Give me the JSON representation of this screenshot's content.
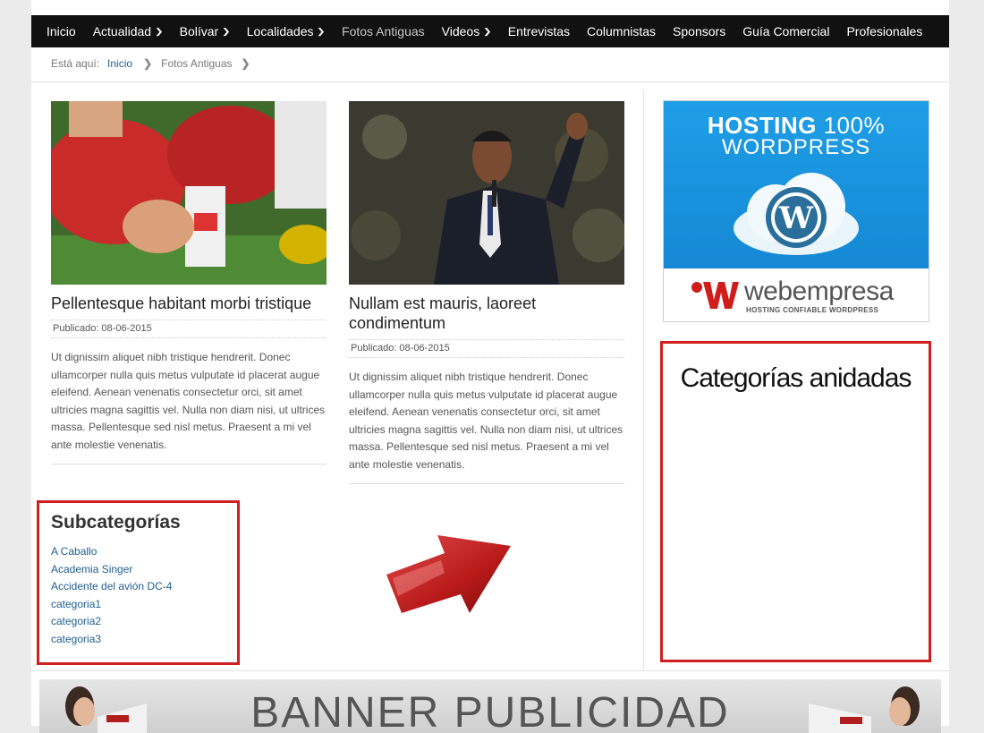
{
  "nav": {
    "items": [
      {
        "label": "Inicio",
        "dropdown": false
      },
      {
        "label": "Actualidad",
        "dropdown": true
      },
      {
        "label": "Bolívar",
        "dropdown": true
      },
      {
        "label": "Localidades",
        "dropdown": true
      },
      {
        "label": "Fotos Antiguas",
        "dropdown": false,
        "active": true
      },
      {
        "label": "Videos",
        "dropdown": true
      },
      {
        "label": "Entrevistas",
        "dropdown": false
      },
      {
        "label": "Columnistas",
        "dropdown": false
      },
      {
        "label": "Sponsors",
        "dropdown": false
      },
      {
        "label": "Guía Comercial",
        "dropdown": false
      },
      {
        "label": "Profesionales",
        "dropdown": false
      }
    ]
  },
  "breadcrumb": {
    "prefix": "Está aquí:",
    "home": "Inicio",
    "current": "Fotos Antiguas"
  },
  "articles": [
    {
      "title": "Pellentesque habitant morbi tristique",
      "meta": "Publicado: 08-06-2015",
      "body": "Ut dignissim aliquet nibh tristique hendrerit. Donec ullamcorper nulla quis metus vulputate id placerat augue eleifend. Aenean venenatis consectetur orci, sit amet ultricies magna sagittis vel. Nulla non diam nisi, ut ultrices massa. Pellentesque sed nisl metus. Praesent a mi vel ante molestie venenatis."
    },
    {
      "title": "Nullam est mauris, laoreet condimentum",
      "meta": "Publicado: 08-06-2015",
      "body": "Ut dignissim aliquet nibh tristique hendrerit. Donec ullamcorper nulla quis metus vulputate id placerat augue eleifend. Aenean venenatis consectetur orci, sit amet ultricies magna sagittis vel. Nulla non diam nisi, ut ultrices massa. Pellentesque sed nisl metus. Praesent a mi vel ante molestie venenatis."
    }
  ],
  "subcategories": {
    "title": "Subcategorías",
    "items": [
      "A Caballo",
      "Academia Singer",
      "Accidente del avión DC-4",
      "categoria1",
      "categoria2",
      "categoria3"
    ]
  },
  "ad": {
    "line1_bold": "HOSTING",
    "line1_rest": " 100%",
    "line2": "WORDPRESS",
    "brand": "webempresa",
    "tagline": "HOSTING CONFIABLE WORDPRESS"
  },
  "nested_categories": {
    "title": "Categorías anidadas"
  },
  "banner": {
    "text": "BANNER PUBLICIDAD"
  },
  "colors": {
    "nav_bg": "#111111",
    "highlight_border": "#d01f1f",
    "link": "#1f5e8f",
    "ad_blue": "#1a96de"
  }
}
